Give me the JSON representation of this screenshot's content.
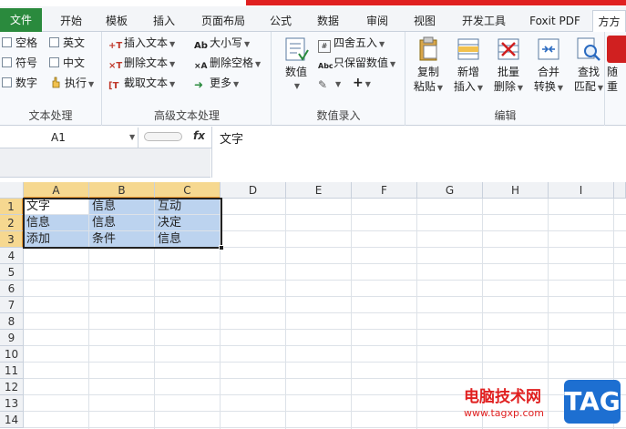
{
  "tabs": [
    "文件",
    "开始",
    "模板",
    "插入",
    "页面布局",
    "公式",
    "数据",
    "审阅",
    "视图",
    "开发工具",
    "Foxit PDF",
    "方方"
  ],
  "ribbon": {
    "group1": {
      "label": "文本处理",
      "items": [
        "空格",
        "英文",
        "符号",
        "中文",
        "数字",
        "执行"
      ]
    },
    "group2": {
      "label": "高级文本处理",
      "items": [
        "插入文本",
        "大小写",
        "删除文本",
        "删除空格",
        "截取文本",
        "更多"
      ]
    },
    "group3": {
      "label": "数值录入",
      "numeric": "数值",
      "round": "四舍五入",
      "keep_value": "只保留数值"
    },
    "group4": {
      "label": "编辑",
      "buttons": [
        {
          "l1": "复制",
          "l2": "粘贴"
        },
        {
          "l1": "新增",
          "l2": "插入"
        },
        {
          "l1": "批量",
          "l2": "删除"
        },
        {
          "l1": "合并",
          "l2": "转换"
        },
        {
          "l1": "查找",
          "l2": "匹配"
        }
      ],
      "cut_label_1": "随",
      "cut_label_2": "重"
    }
  },
  "formula_bar": {
    "name_box": "A1",
    "fx": "fx",
    "content": "文字"
  },
  "columns": [
    "A",
    "B",
    "C",
    "D",
    "E",
    "F",
    "G",
    "H",
    "I"
  ],
  "rows": [
    "1",
    "2",
    "3",
    "4",
    "5",
    "6",
    "7",
    "8",
    "9",
    "10",
    "11",
    "12",
    "13",
    "14"
  ],
  "cells": [
    [
      "文字",
      "信息",
      "互动"
    ],
    [
      "信息",
      "信息",
      "决定"
    ],
    [
      "添加",
      "条件",
      "信息"
    ]
  ],
  "watermark": {
    "site": "电脑技术网",
    "url": "www.tagxp.com",
    "tag": "TAG"
  },
  "colors": {
    "file_tab": "#2a8a3d",
    "selection_fill": "#bcd3ef",
    "header_selected": "#f6d890",
    "accent_red": "#e02020",
    "tag_blue": "#1d6fd1"
  }
}
